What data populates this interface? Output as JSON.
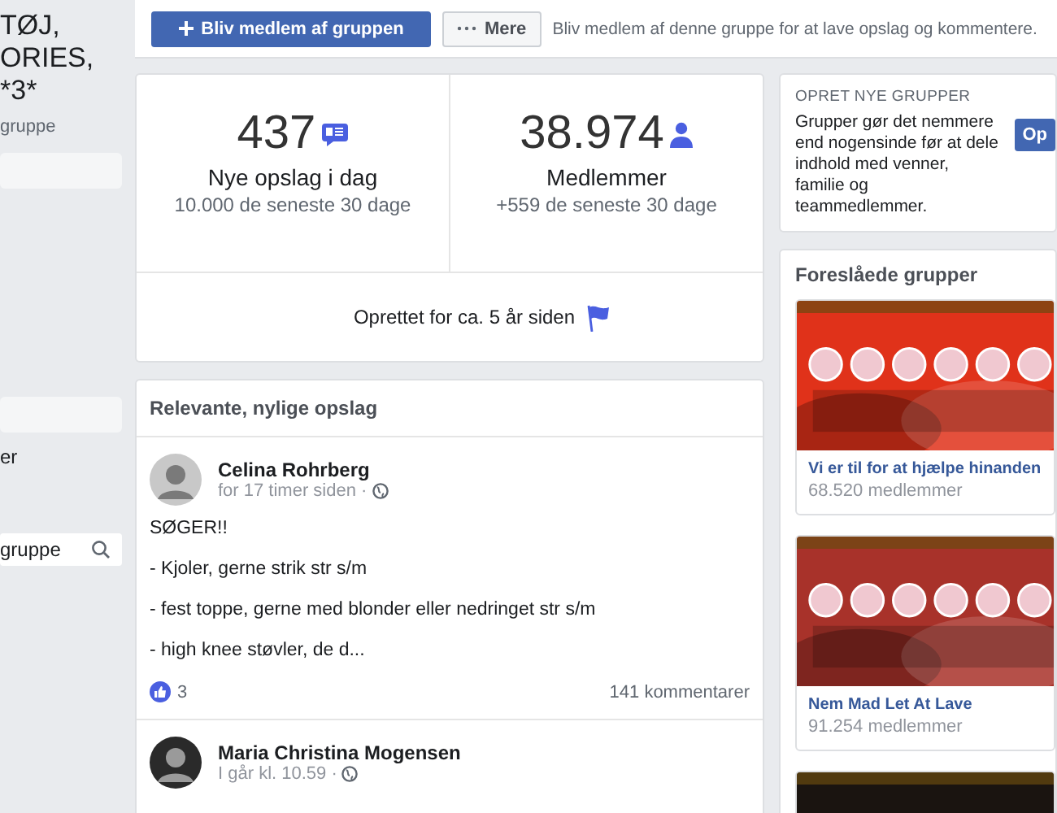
{
  "sidebar": {
    "title_lines": [
      "TØJ,",
      "ORIES,",
      "*3*"
    ],
    "subtitle": "gruppe",
    "link": "er",
    "search": {
      "placeholder": "gruppe"
    }
  },
  "actions": {
    "join_button": "Bliv medlem af gruppen",
    "more_button": "Mere",
    "hint": "Bliv medlem af denne gruppe for at lave opslag og kommentere."
  },
  "stats": [
    {
      "kind": "posts",
      "value": "437",
      "label": "Nye opslag i dag",
      "sub": "10.000 de seneste 30 dage"
    },
    {
      "kind": "members",
      "value": "38.974",
      "label": "Medlemmer",
      "sub": "+559 de seneste 30 dage"
    }
  ],
  "created": "Oprettet for ca. 5 år siden",
  "posts": {
    "title": "Relevante, nylige opslag",
    "items": [
      {
        "author": "Celina Rohrberg",
        "time": "for 17 timer siden ·",
        "lines": [
          "SØGER!!",
          "- Kjoler, gerne strik str s/m",
          "- fest toppe, gerne med blonder eller nedringet str s/m",
          "- high knee støvler, de d..."
        ],
        "likes": "3",
        "comments": "141 kommentarer"
      },
      {
        "author": "Maria Christina Mogensen",
        "time": "I går kl. 10.59 ·"
      }
    ]
  },
  "create_groups": {
    "heading": "OPRET NYE GRUPPER",
    "text": "Grupper gør det nemmere end nogensinde før at dele indhold med venner, familie og teammedlemmer.",
    "button": "Op"
  },
  "suggested": {
    "heading": "Foreslåede grupper",
    "groups": [
      {
        "name": "Vi er til for at hjælpe hinanden",
        "members": "68.520 medlemmer",
        "color": "#e0321a"
      },
      {
        "name": "Nem Mad Let At Lave",
        "members": "91.254 medlemmer",
        "color": "#a8322a"
      },
      {
        "color": "#1a1410"
      }
    ]
  }
}
